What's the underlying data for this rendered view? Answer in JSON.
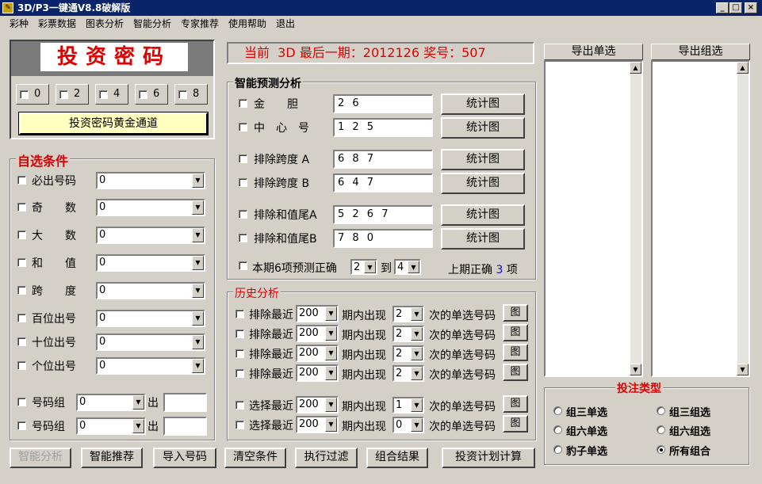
{
  "window": {
    "title": "3D/P3一键通V8.8破解版",
    "min": "_",
    "max": "□",
    "close": "×"
  },
  "menu": [
    "彩种",
    "彩票数据",
    "图表分析",
    "智能分析",
    "专家推荐",
    "使用帮助",
    "退出"
  ],
  "banner": {
    "title": "投资密码",
    "digits": [
      "0",
      "2",
      "4",
      "6",
      "8"
    ],
    "gold_button": "投资密码黄金通道"
  },
  "status": {
    "text": "当前  3D 最后一期：2012126 奖号：507"
  },
  "custom": {
    "legend": "自选条件",
    "rows": [
      {
        "label": "必出号码",
        "value": "0"
      },
      {
        "label": "奇　　数",
        "value": "0"
      },
      {
        "label": "大　　数",
        "value": "0"
      },
      {
        "label": "和　　值",
        "value": "0"
      },
      {
        "label": "跨　　度",
        "value": "0"
      },
      {
        "label": "百位出号",
        "value": "0"
      },
      {
        "label": "十位出号",
        "value": "0"
      },
      {
        "label": "个位出号",
        "value": "0"
      }
    ],
    "groups": [
      {
        "label": "号码组",
        "value": "0",
        "out": "出"
      },
      {
        "label": "号码组",
        "value": "0",
        "out": "出"
      }
    ]
  },
  "predict": {
    "legend": "智能预测分析",
    "chart_btn": "统计图",
    "rows": [
      {
        "label": "金　　胆",
        "value": "2 6"
      },
      {
        "label": "中　心　号",
        "value": "1 2 5"
      },
      {
        "label": "排除跨度 A",
        "value": "6 8 7"
      },
      {
        "label": "排除跨度 B",
        "value": "6 4 7"
      },
      {
        "label": "排除和值尾A",
        "value": "5 2 6 7"
      },
      {
        "label": "排除和值尾B",
        "value": "7 8 0"
      }
    ],
    "footer": {
      "label": "本期6项预测正确",
      "from": "2",
      "to_label": "到",
      "to": "4",
      "last_label": "上期正确",
      "last_value": "3",
      "last_unit": "项"
    }
  },
  "history": {
    "legend": "历史分析",
    "chart_btn": "图",
    "mid": "期内出现",
    "tail": "次的单选号码",
    "rows": [
      {
        "label": "排除最近",
        "period": "200",
        "times": "2"
      },
      {
        "label": "排除最近",
        "period": "200",
        "times": "2"
      },
      {
        "label": "排除最近",
        "period": "200",
        "times": "2"
      },
      {
        "label": "排除最近",
        "period": "200",
        "times": "2"
      },
      {
        "label": "选择最近",
        "period": "200",
        "times": "1"
      },
      {
        "label": "选择最近",
        "period": "200",
        "times": "0"
      }
    ]
  },
  "export": {
    "single": "导出单选",
    "group": "导出组选"
  },
  "bet": {
    "legend": "投注类型",
    "options": [
      "组三单选",
      "组三组选",
      "组六单选",
      "组六组选",
      "豹子单选",
      "所有组合"
    ],
    "selected": 5
  },
  "bottom": [
    "智能分析",
    "智能推荐",
    "导入号码",
    "清空条件",
    "执行过滤",
    "组合结果",
    "投资计划计算"
  ],
  "colors": {
    "title_red": "#e00000",
    "accent_blue": "#1010c0",
    "highlight": "#ffffc0"
  }
}
